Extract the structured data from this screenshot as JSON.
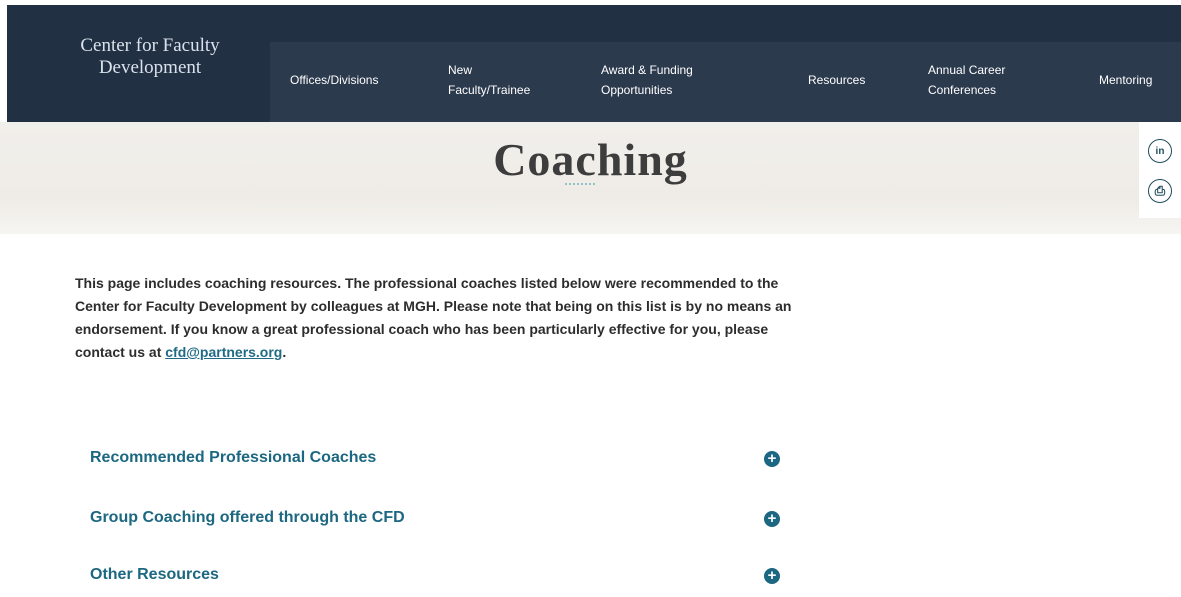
{
  "site": {
    "title_line1": "Center for Faculty",
    "title_line2": "Development"
  },
  "nav": {
    "items": [
      {
        "label": "Offices/Divisions"
      },
      {
        "label_line1": "New",
        "label_line2": "Faculty/Trainee"
      },
      {
        "label_line1": "Award & Funding",
        "label_line2": "Opportunities"
      },
      {
        "label": "Resources"
      },
      {
        "label_line1": "Annual Career",
        "label_line2": "Conferences"
      },
      {
        "label": "Mentoring"
      }
    ]
  },
  "page": {
    "title": "Coaching"
  },
  "share": {
    "linkedin": "in",
    "print": "⎙"
  },
  "intro": {
    "text": "This page includes coaching resources. The professional coaches listed below were recommended to the Center for Faculty Development by colleagues at MGH. Please note that being on this list is by no means an endorsement. If you know a great professional coach who has been particularly effective for you, please contact us at ",
    "email": "cfd@partners.org",
    "suffix": "."
  },
  "accordion": {
    "items": [
      {
        "label": "Recommended Professional Coaches",
        "icon": "+"
      },
      {
        "label": "Group Coaching offered through the CFD",
        "icon": "+"
      },
      {
        "label": "Other Resources",
        "icon": "+"
      }
    ]
  },
  "colors": {
    "header_bg": "#223043",
    "accent_teal": "#1c6781"
  }
}
